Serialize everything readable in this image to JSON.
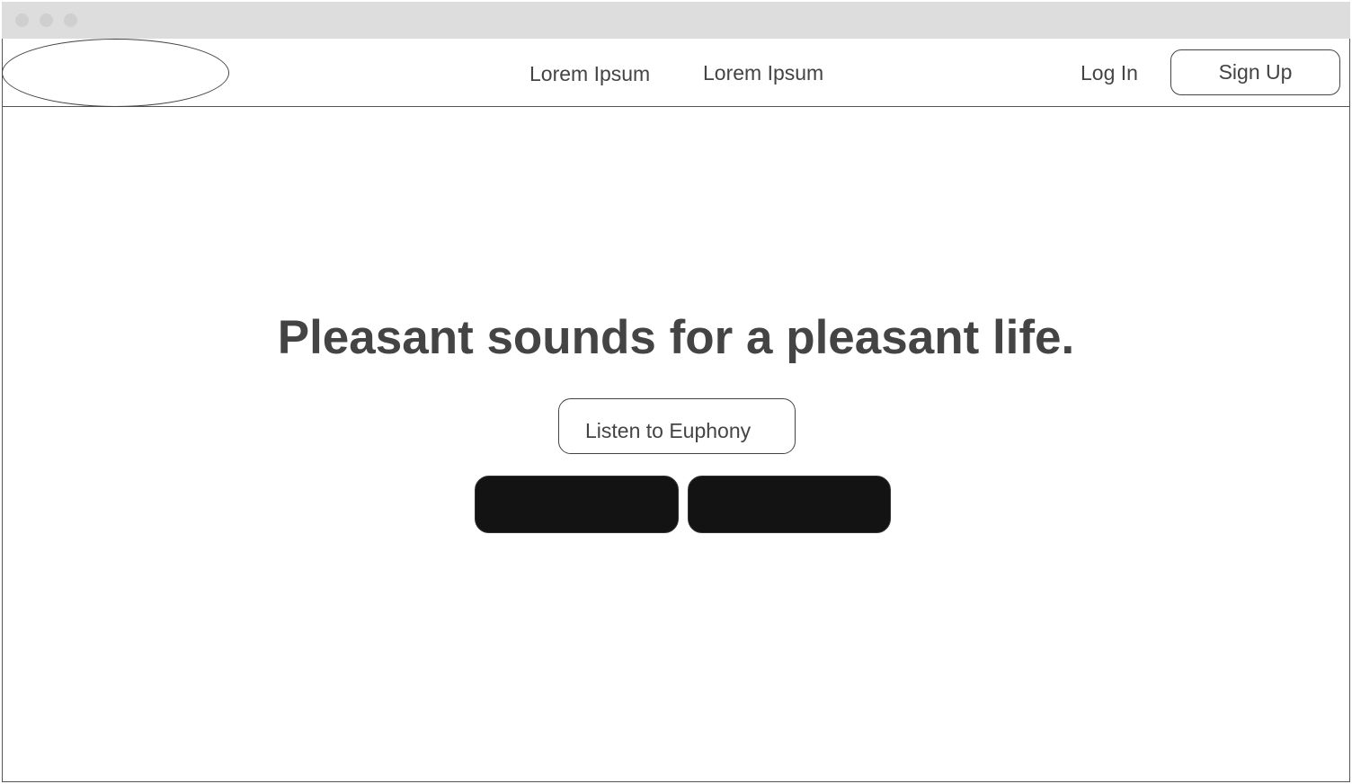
{
  "window": {
    "dots": [
      "close",
      "minimize",
      "maximize"
    ]
  },
  "header": {
    "logo_icon": "logo-placeholder-ellipse",
    "nav": [
      {
        "label": "Lorem Ipsum"
      },
      {
        "label": "Lorem Ipsum"
      }
    ],
    "login_label": "Log In",
    "signup_label": "Sign Up"
  },
  "hero": {
    "headline": "Pleasant sounds for a pleasant life.",
    "listen_label": "Listen to Euphony",
    "store_buttons": [
      {
        "label": ""
      },
      {
        "label": ""
      }
    ]
  },
  "colors": {
    "text": "#444444",
    "border": "#555555",
    "chrome": "#dddddd",
    "dark_button": "#131313"
  }
}
